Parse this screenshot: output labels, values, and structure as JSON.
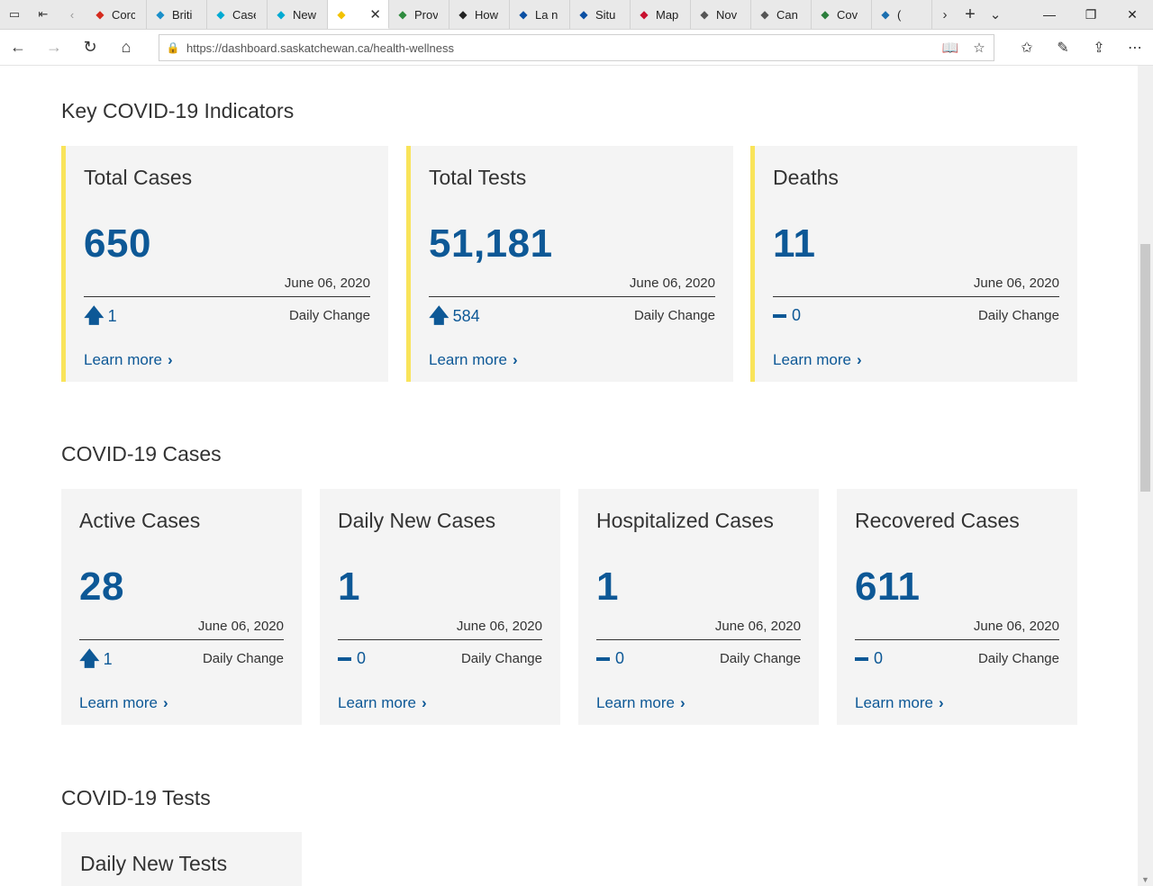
{
  "browser": {
    "tabs": [
      {
        "label": "Corc",
        "icon": "maple-leaf-icon",
        "color": "#d52b1e"
      },
      {
        "label": "Briti",
        "icon": "bc-logo-icon",
        "color": "#1a8fc9"
      },
      {
        "label": "Case",
        "icon": "alberta-icon",
        "color": "#00aad2"
      },
      {
        "label": "New",
        "icon": "alberta-icon",
        "color": "#00aad2"
      },
      {
        "label": "",
        "icon": "saskatchewan-icon",
        "color": "#f2c200",
        "active": true
      },
      {
        "label": "Prov",
        "icon": "manitoba-icon",
        "color": "#2e8b3e"
      },
      {
        "label": "How",
        "icon": "ontario-icon",
        "color": "#222222"
      },
      {
        "label": "La n",
        "icon": "quebec-icon",
        "color": "#0a4fa3"
      },
      {
        "label": "Situ",
        "icon": "quebec-icon",
        "color": "#0a4fa3"
      },
      {
        "label": "Map",
        "icon": "nb-icon",
        "color": "#c8102e"
      },
      {
        "label": "Nov",
        "icon": "ns-icon",
        "color": "#555555"
      },
      {
        "label": "Can",
        "icon": "page-icon",
        "color": "#555555"
      },
      {
        "label": "Cov",
        "icon": "globe-icon",
        "color": "#2a7d3b"
      },
      {
        "label": "(",
        "icon": "nl-icon",
        "color": "#1b6fb0"
      }
    ],
    "url": "https://dashboard.saskatchewan.ca/health-wellness"
  },
  "sections": {
    "key": {
      "title": "Key COVID-19 Indicators",
      "cards": [
        {
          "title": "Total Cases",
          "value": "650",
          "date": "June 06, 2020",
          "change": "1",
          "trend": "up",
          "change_label": "Daily Change",
          "link": "Learn more"
        },
        {
          "title": "Total Tests",
          "value": "51,181",
          "date": "June 06, 2020",
          "change": "584",
          "trend": "up",
          "change_label": "Daily Change",
          "link": "Learn more"
        },
        {
          "title": "Deaths",
          "value": "11",
          "date": "June 06, 2020",
          "change": "0",
          "trend": "flat",
          "change_label": "Daily Change",
          "link": "Learn more"
        }
      ]
    },
    "cases": {
      "title": "COVID-19 Cases",
      "cards": [
        {
          "title": "Active Cases",
          "value": "28",
          "date": "June 06, 2020",
          "change": "1",
          "trend": "up",
          "change_label": "Daily Change",
          "link": "Learn more"
        },
        {
          "title": "Daily New Cases",
          "value": "1",
          "date": "June 06, 2020",
          "change": "0",
          "trend": "flat",
          "change_label": "Daily Change",
          "link": "Learn more"
        },
        {
          "title": "Hospitalized Cases",
          "value": "1",
          "date": "June 06, 2020",
          "change": "0",
          "trend": "flat",
          "change_label": "Daily Change",
          "link": "Learn more"
        },
        {
          "title": "Recovered Cases",
          "value": "611",
          "date": "June 06, 2020",
          "change": "0",
          "trend": "flat",
          "change_label": "Daily Change",
          "link": "Learn more"
        }
      ]
    },
    "tests": {
      "title": "COVID-19 Tests",
      "cards": [
        {
          "title": "Daily New Tests"
        }
      ]
    }
  },
  "colors": {
    "accent": "#0d5896",
    "kpi_border": "#f9e45a",
    "card_bg": "#f4f4f4"
  }
}
